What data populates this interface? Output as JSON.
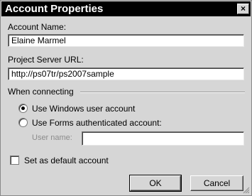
{
  "window": {
    "title": "Account Properties",
    "close_label": "×"
  },
  "account_name": {
    "label": "Account Name:",
    "value": "Elaine Marmel"
  },
  "server_url": {
    "label": "Project Server URL:",
    "value": "http://ps07tr/ps2007sample"
  },
  "connecting": {
    "group_label": "When connecting",
    "windows_option": "Use Windows user account",
    "forms_option": "Use Forms authenticated account:",
    "selected": "windows",
    "user_name_label": "User name:",
    "user_name_value": ""
  },
  "default_account": {
    "label": "Set as default account",
    "checked": false
  },
  "buttons": {
    "ok": "OK",
    "cancel": "Cancel"
  }
}
